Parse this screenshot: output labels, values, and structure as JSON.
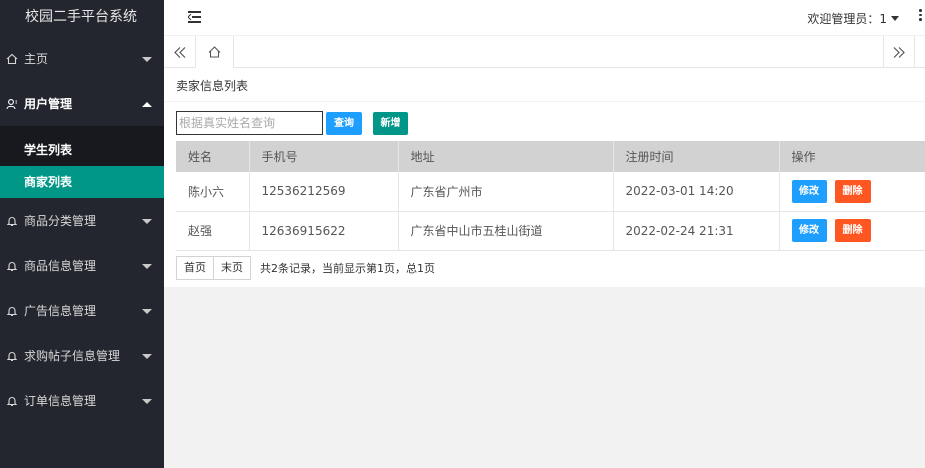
{
  "app": {
    "title": "校园二手平台系统"
  },
  "header": {
    "welcome": "欢迎管理员：1"
  },
  "sidebar": {
    "items": [
      {
        "label": "主页",
        "icon": "home-icon"
      },
      {
        "label": "用户管理",
        "icon": "user-icon",
        "open": true,
        "children": [
          {
            "label": "学生列表"
          },
          {
            "label": "商家列表",
            "active": true
          }
        ]
      },
      {
        "label": "商品分类管理",
        "icon": "bell-icon"
      },
      {
        "label": "商品信息管理",
        "icon": "bell-icon"
      },
      {
        "label": "广告信息管理",
        "icon": "bell-icon"
      },
      {
        "label": "求购帖子信息管理",
        "icon": "bell-icon"
      },
      {
        "label": "订单信息管理",
        "icon": "bell-icon"
      }
    ]
  },
  "card": {
    "title": "卖家信息列表"
  },
  "search": {
    "placeholder": "根据真实姓名查询",
    "value": ""
  },
  "buttons": {
    "query": "查询",
    "add": "新增",
    "edit": "修改",
    "delete": "删除"
  },
  "table": {
    "columns": [
      "姓名",
      "手机号",
      "地址",
      "注册时间",
      "操作"
    ],
    "rows": [
      {
        "name": "陈小六",
        "phone": "12536212569",
        "address": "广东省广州市",
        "registered": "2022-03-01 14:20"
      },
      {
        "name": "赵强",
        "phone": "12636915622",
        "address": "广东省中山市五桂山街道",
        "registered": "2022-02-24 21:31"
      }
    ]
  },
  "pager": {
    "first": "首页",
    "last": "末页",
    "info": "共2条记录，当前显示第1页，总1页"
  },
  "colors": {
    "sidebar_bg": "#23262e",
    "active": "#009688",
    "primary": "#1e9fff",
    "danger": "#ff5722"
  }
}
